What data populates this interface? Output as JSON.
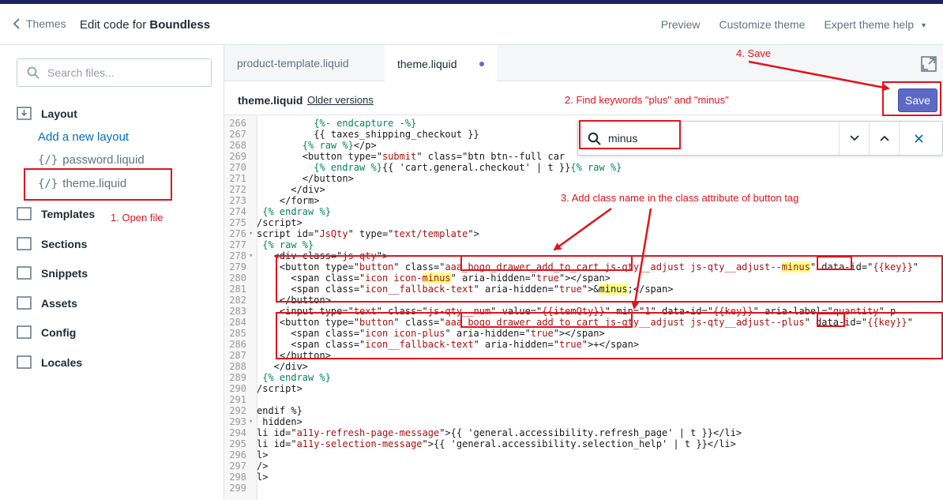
{
  "topbar": {
    "back_label": "Themes",
    "title_prefix": "Edit code for",
    "theme_name": "Boundless",
    "links": {
      "preview": "Preview",
      "customize": "Customize theme",
      "help": "Expert theme help"
    }
  },
  "sidebar": {
    "search_placeholder": "Search files...",
    "layout_label": "Layout",
    "add_layout": "Add a new layout",
    "files": [
      "password.liquid",
      "theme.liquid"
    ],
    "brace_glyph": "{/}",
    "folders": [
      "Templates",
      "Sections",
      "Snippets",
      "Assets",
      "Config",
      "Locales"
    ]
  },
  "editor": {
    "tabs": [
      "product-template.liquid",
      "theme.liquid"
    ],
    "file_name": "theme.liquid",
    "older_versions": "Older versions",
    "save_label": "Save",
    "search_value": "minus",
    "lines": [
      {
        "n": "266",
        "t": "          {%- endcapture -%}"
      },
      {
        "n": "267",
        "t": "          {{ taxes_shipping_checkout }}"
      },
      {
        "n": "268",
        "t": "        {% raw %}</p>"
      },
      {
        "n": "269",
        "t": "        <button type=\"submit\" class=\"btn btn--full car"
      },
      {
        "n": "270",
        "t": "          {% endraw %}{{ 'cart.general.checkout' | t }}{% raw %}"
      },
      {
        "n": "271",
        "t": "        </button>"
      },
      {
        "n": "272",
        "t": "      </div>"
      },
      {
        "n": "273",
        "t": "    </form>"
      },
      {
        "n": "274",
        "t": " {% endraw %}"
      },
      {
        "n": "275",
        "t": "/script>"
      },
      {
        "n": "276",
        "t": "script id=\"JsQty\" type=\"text/template\">"
      },
      {
        "n": "277",
        "t": " {% raw %}"
      },
      {
        "n": "278",
        "t": "   <div class=\"js-qty\">"
      },
      {
        "n": "279",
        "t": "    <button type=\"button\" class=\"aaa_bogo_drawer_add_to_cart js-qty__adjust js-qty__adjust--minus\" data-id=\"{{key}}\""
      },
      {
        "n": "280",
        "t": "      <span class=\"icon icon-minus\" aria-hidden=\"true\"></span>"
      },
      {
        "n": "281",
        "t": "      <span class=\"icon__fallback-text\" aria-hidden=\"true\">&minus;</span>"
      },
      {
        "n": "282",
        "t": "    </button>"
      },
      {
        "n": "283",
        "t": "    <input type=\"text\" class=\"js-qty__num\" value=\"{{itemQty}}\" min=\"1\" data-id=\"{{key}}\" aria-label=\"quantity\" p"
      },
      {
        "n": "284",
        "t": "    <button type=\"button\" class=\"aaa_bogo_drawer_add_to_cart js-qty__adjust js-qty__adjust--plus\" data-id=\"{{key}}\""
      },
      {
        "n": "285",
        "t": "      <span class=\"icon icon-plus\" aria-hidden=\"true\"></span>"
      },
      {
        "n": "286",
        "t": "      <span class=\"icon__fallback-text\" aria-hidden=\"true\">+</span>"
      },
      {
        "n": "287",
        "t": "    </button>"
      },
      {
        "n": "288",
        "t": "   </div>"
      },
      {
        "n": "289",
        "t": " {% endraw %}"
      },
      {
        "n": "290",
        "t": "/script>"
      },
      {
        "n": "291",
        "t": ""
      },
      {
        "n": "292",
        "t": "endif %}"
      },
      {
        "n": "293",
        "t": " hidden>"
      },
      {
        "n": "294",
        "t": "li id=\"a11y-refresh-page-message\">{{ 'general.accessibility.refresh_page' | t }}</li>"
      },
      {
        "n": "295",
        "t": "li id=\"a11y-selection-message\">{{ 'general.accessibility.selection_help' | t }}</li>"
      },
      {
        "n": "296",
        "t": "l>"
      },
      {
        "n": "297",
        "t": "/>"
      },
      {
        "n": "298",
        "t": "l>"
      },
      {
        "n": "299",
        "t": ""
      }
    ]
  },
  "annotations": {
    "open_file": "1. Open file",
    "find_keywords": "2. Find keywords \"plus\" and \"minus\"",
    "add_class": "3. Add class name in the class attribute of button tag",
    "save": "4. Save"
  },
  "colors": {
    "accent": "#5c6ac4",
    "annotation": "#e0141e",
    "link": "#006fbb",
    "topstrip": "#1c2260"
  }
}
